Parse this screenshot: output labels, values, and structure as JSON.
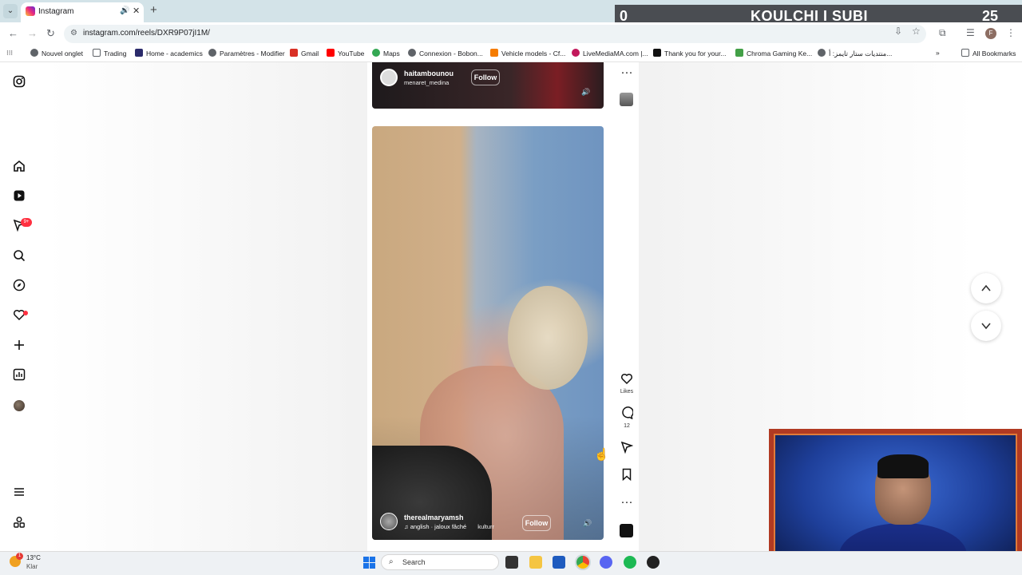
{
  "browser": {
    "tab": {
      "title": "Instagram"
    },
    "url": "instagram.com/reels/DXR9P07jI1M/",
    "bookmarks": [
      {
        "label": "Nouvel onglet",
        "icon": "globe-icon",
        "color": "#5f6368"
      },
      {
        "label": "Trading",
        "icon": "folder-icon",
        "color": "#5f6368"
      },
      {
        "label": "Home - academics",
        "icon": "puzzle-icon",
        "color": "#2b2b6b"
      },
      {
        "label": "Paramètres - Modifier",
        "icon": "gear-icon",
        "color": "#5f6368"
      },
      {
        "label": "Gmail",
        "icon": "gmail-icon",
        "color": "#d93025"
      },
      {
        "label": "YouTube",
        "icon": "youtube-icon",
        "color": "#ff0000"
      },
      {
        "label": "Maps",
        "icon": "maps-icon",
        "color": "#34a853"
      },
      {
        "label": "Connexion - Bobon...",
        "icon": "globe-icon",
        "color": "#5f6368"
      },
      {
        "label": "Vehicle models - Cf...",
        "icon": "vehicle-icon",
        "color": "#f57c00"
      },
      {
        "label": "LiveMediaMA.com |...",
        "icon": "livemedia-icon",
        "color": "#c2185b"
      },
      {
        "label": "Thank you for your...",
        "icon": "xlogo-icon",
        "color": "#111111"
      },
      {
        "label": "Chroma Gaming Ke...",
        "icon": "chroma-icon",
        "color": "#43a047"
      },
      {
        "label": "منتديات ستار تايمز: أ...",
        "icon": "globe-icon",
        "color": "#5f6368"
      }
    ],
    "all_bookmarks": "All Bookmarks",
    "profile_initial": "F"
  },
  "stream_overlay": {
    "score_left": "0",
    "banner": "KOULCHI I SUBI",
    "score_right": "25"
  },
  "instagram": {
    "nav": {
      "messages_badge": "9+"
    },
    "reel_prev": {
      "username": "haitambounou",
      "subtitle": "menaret_medina",
      "follow": "Follow"
    },
    "reel_current": {
      "username": "therealmaryamsh",
      "music": "anglish · jaloux fâché",
      "music_tag": "kulturr",
      "follow": "Follow"
    },
    "actions": {
      "likes_label": "Likes",
      "comments_count": "12"
    }
  },
  "taskbar": {
    "temperature": "13°C",
    "weather": "Klar",
    "search_label": "Search"
  },
  "colors": {
    "accent_red": "#ff3040",
    "overlay_gray": "#4a4d52",
    "webcam_frame": "#b13a22"
  }
}
